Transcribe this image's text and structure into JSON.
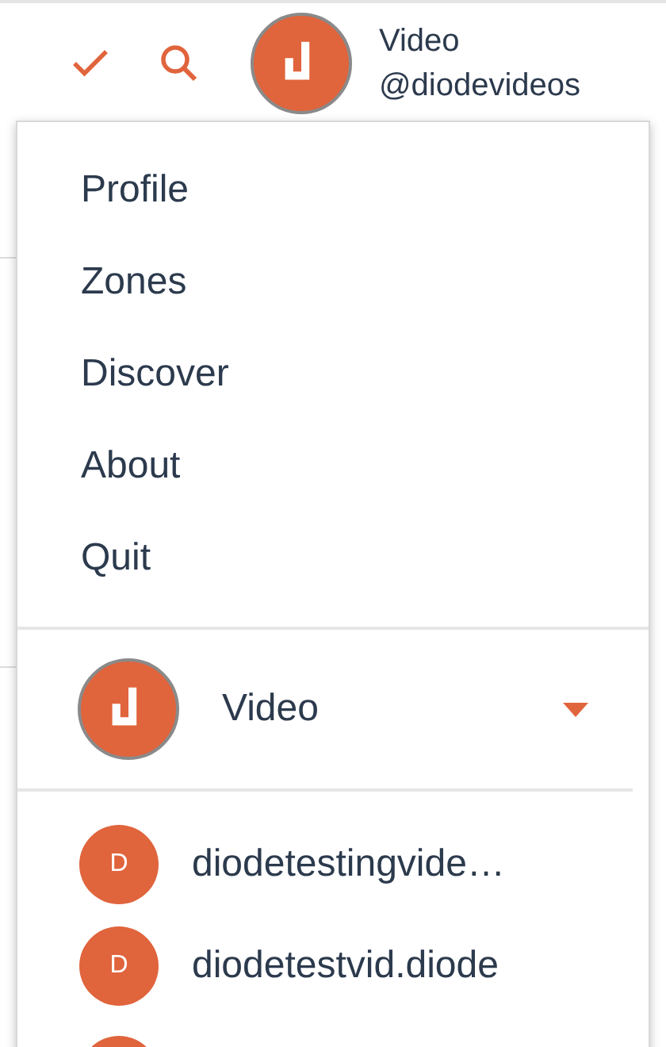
{
  "header": {
    "account_name": "Video",
    "account_handle": "@diodevideos"
  },
  "menu": {
    "items": [
      {
        "label": "Profile"
      },
      {
        "label": "Zones"
      },
      {
        "label": "Discover"
      },
      {
        "label": "About"
      },
      {
        "label": "Quit"
      }
    ],
    "current_account": {
      "name": "Video",
      "expanded": false
    },
    "accounts": [
      {
        "initial": "D",
        "name": "diodetestingvide…"
      },
      {
        "initial": "D",
        "name": "diodetestvid.diode"
      }
    ]
  }
}
